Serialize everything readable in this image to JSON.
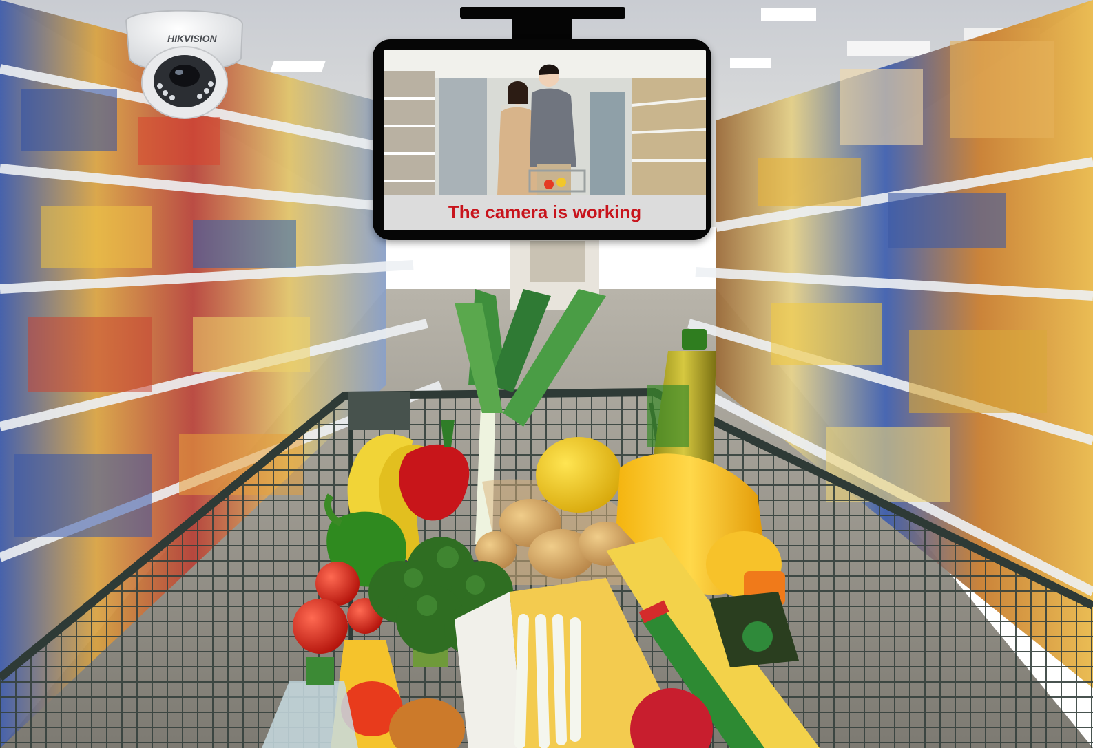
{
  "camera": {
    "brand": "HIKVISION"
  },
  "monitor": {
    "status_text": "The camera is working"
  },
  "colors": {
    "status_text": "#c8141c",
    "monitor_bezel": "#060606",
    "status_bar": "#dcdcdc"
  }
}
